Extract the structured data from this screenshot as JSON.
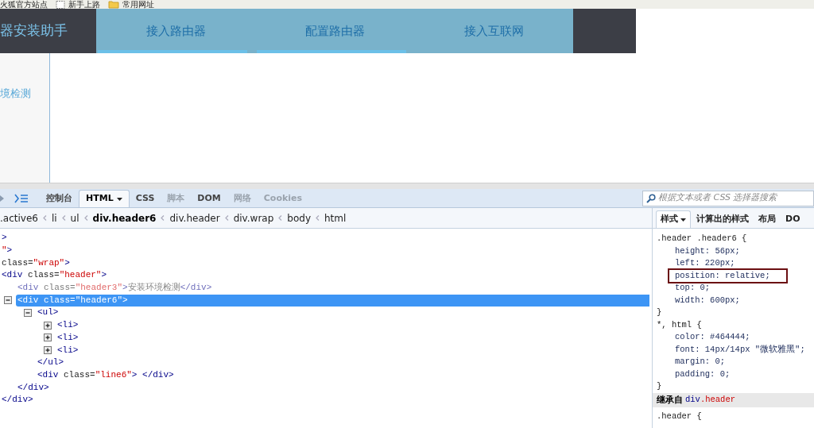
{
  "bookmarks": [
    {
      "label": "火狐官方站点",
      "kind": "page"
    },
    {
      "label": "新手上路",
      "kind": "page"
    },
    {
      "label": "常用网址",
      "kind": "folder"
    }
  ],
  "page": {
    "title": "器安装助手",
    "nav": [
      {
        "label": "接入路由器",
        "underlined": true
      },
      {
        "label": "配置路由器",
        "underlined": true
      },
      {
        "label": "接入互联网",
        "underlined": false
      }
    ],
    "sidebar_item": "境检测"
  },
  "devtools": {
    "tabs": [
      {
        "label": "控制台",
        "selected": false,
        "disabled": false,
        "menu": false
      },
      {
        "label": "HTML",
        "selected": true,
        "disabled": false,
        "menu": true
      },
      {
        "label": "CSS",
        "selected": false,
        "disabled": false,
        "menu": false
      },
      {
        "label": "脚本",
        "selected": false,
        "disabled": true,
        "menu": false
      },
      {
        "label": "DOM",
        "selected": false,
        "disabled": false,
        "menu": false
      },
      {
        "label": "网络",
        "selected": false,
        "disabled": true,
        "menu": false
      },
      {
        "label": "Cookies",
        "selected": false,
        "disabled": true,
        "menu": false
      }
    ],
    "search": {
      "placeholder": "根据文本或者 CSS 选择器搜索"
    },
    "breadcrumb": [
      {
        "label": ".active6",
        "selected": false
      },
      {
        "label": "li",
        "selected": false
      },
      {
        "label": "ul",
        "selected": false
      },
      {
        "label": "div.header6",
        "selected": true
      },
      {
        "label": "div.header",
        "selected": false
      },
      {
        "label": "div.wrap",
        "selected": false
      },
      {
        "label": "body",
        "selected": false
      },
      {
        "label": "html",
        "selected": false
      }
    ],
    "tree": [
      {
        "parts": [
          {
            "kind": "tag",
            "text": ">"
          }
        ]
      },
      {
        "parts": [
          {
            "kind": "value",
            "text": "\""
          },
          {
            "kind": "tag",
            "text": ">"
          }
        ]
      },
      {
        "parts": [
          {
            "kind": "attr",
            "text": "class="
          },
          {
            "kind": "value",
            "text": "\"wrap\""
          },
          {
            "kind": "tag",
            "text": ">"
          }
        ],
        "children": [
          {
            "parts": [
              {
                "kind": "tag",
                "text": "<div"
              },
              {
                "kind": "attr",
                "text": " class="
              },
              {
                "kind": "value",
                "text": "\"header\""
              },
              {
                "kind": "tag",
                "text": ">"
              }
            ],
            "children": [
              {
                "dimmed": true,
                "parts": [
                  {
                    "kind": "tag",
                    "text": "<div"
                  },
                  {
                    "kind": "attr",
                    "text": " class="
                  },
                  {
                    "kind": "value",
                    "text": "\"header3\""
                  },
                  {
                    "kind": "tag",
                    "text": ">"
                  },
                  {
                    "kind": "text",
                    "text": "安装环境检测"
                  },
                  {
                    "kind": "tag",
                    "text": "</div>"
                  }
                ]
              },
              {
                "selected": true,
                "expanded": true,
                "parts": [
                  {
                    "kind": "tag",
                    "text": "<div"
                  },
                  {
                    "kind": "attr",
                    "text": " class="
                  },
                  {
                    "kind": "value",
                    "text": "\"header6\""
                  },
                  {
                    "kind": "tag",
                    "text": ">"
                  }
                ],
                "children": [
                  {
                    "expanded": true,
                    "parts": [
                      {
                        "kind": "tag",
                        "text": "<ul>"
                      }
                    ],
                    "children": [
                      {
                        "expanded": false,
                        "parts": [
                          {
                            "kind": "tag",
                            "text": "<li>"
                          }
                        ]
                      },
                      {
                        "expanded": false,
                        "parts": [
                          {
                            "kind": "tag",
                            "text": "<li>"
                          }
                        ]
                      },
                      {
                        "expanded": false,
                        "parts": [
                          {
                            "kind": "tag",
                            "text": "<li>"
                          }
                        ]
                      }
                    ]
                  },
                  {
                    "parts": [
                      {
                        "kind": "tag",
                        "text": "</ul>"
                      }
                    ]
                  },
                  {
                    "parts": [
                      {
                        "kind": "tag",
                        "text": "<div"
                      },
                      {
                        "kind": "attr",
                        "text": " class="
                      },
                      {
                        "kind": "value",
                        "text": "\"line6\""
                      },
                      {
                        "kind": "tag",
                        "text": "> </div>"
                      }
                    ]
                  }
                ]
              },
              {
                "parts": [
                  {
                    "kind": "tag",
                    "text": "</div>"
                  }
                ]
              }
            ]
          },
          {
            "parts": [
              {
                "kind": "tag",
                "text": "</div>"
              }
            ]
          }
        ]
      }
    ],
    "side_tabs": [
      {
        "label": "样式",
        "selected": true,
        "menu": true
      },
      {
        "label": "计算出的样式",
        "selected": false,
        "menu": false
      },
      {
        "label": "布局",
        "selected": false,
        "menu": false
      },
      {
        "label": "DO",
        "selected": false,
        "menu": false
      }
    ],
    "rules": [
      {
        "selector": ".header .header6 {",
        "properties": [
          {
            "text": "height: 56px;",
            "highlighted": false
          },
          {
            "text": "left: 220px;",
            "highlighted": false
          },
          {
            "text": "position: relative;",
            "highlighted": true
          },
          {
            "text": "top: 0;",
            "highlighted": false
          },
          {
            "text": "width: 600px;",
            "highlighted": false
          }
        ],
        "close": "}"
      },
      {
        "selector": "*, html {",
        "properties": [
          {
            "text": "color: #464444;",
            "highlighted": false
          },
          {
            "text": "font: 14px/14px \"微软雅黑\";",
            "highlighted": false
          },
          {
            "text": "margin: 0;",
            "highlighted": false
          },
          {
            "text": "padding: 0;",
            "highlighted": false
          }
        ],
        "close": "}"
      }
    ],
    "inherited": {
      "label": "继承自",
      "tag": "div",
      "class": ".header"
    },
    "inherited_rule": ".header {"
  }
}
